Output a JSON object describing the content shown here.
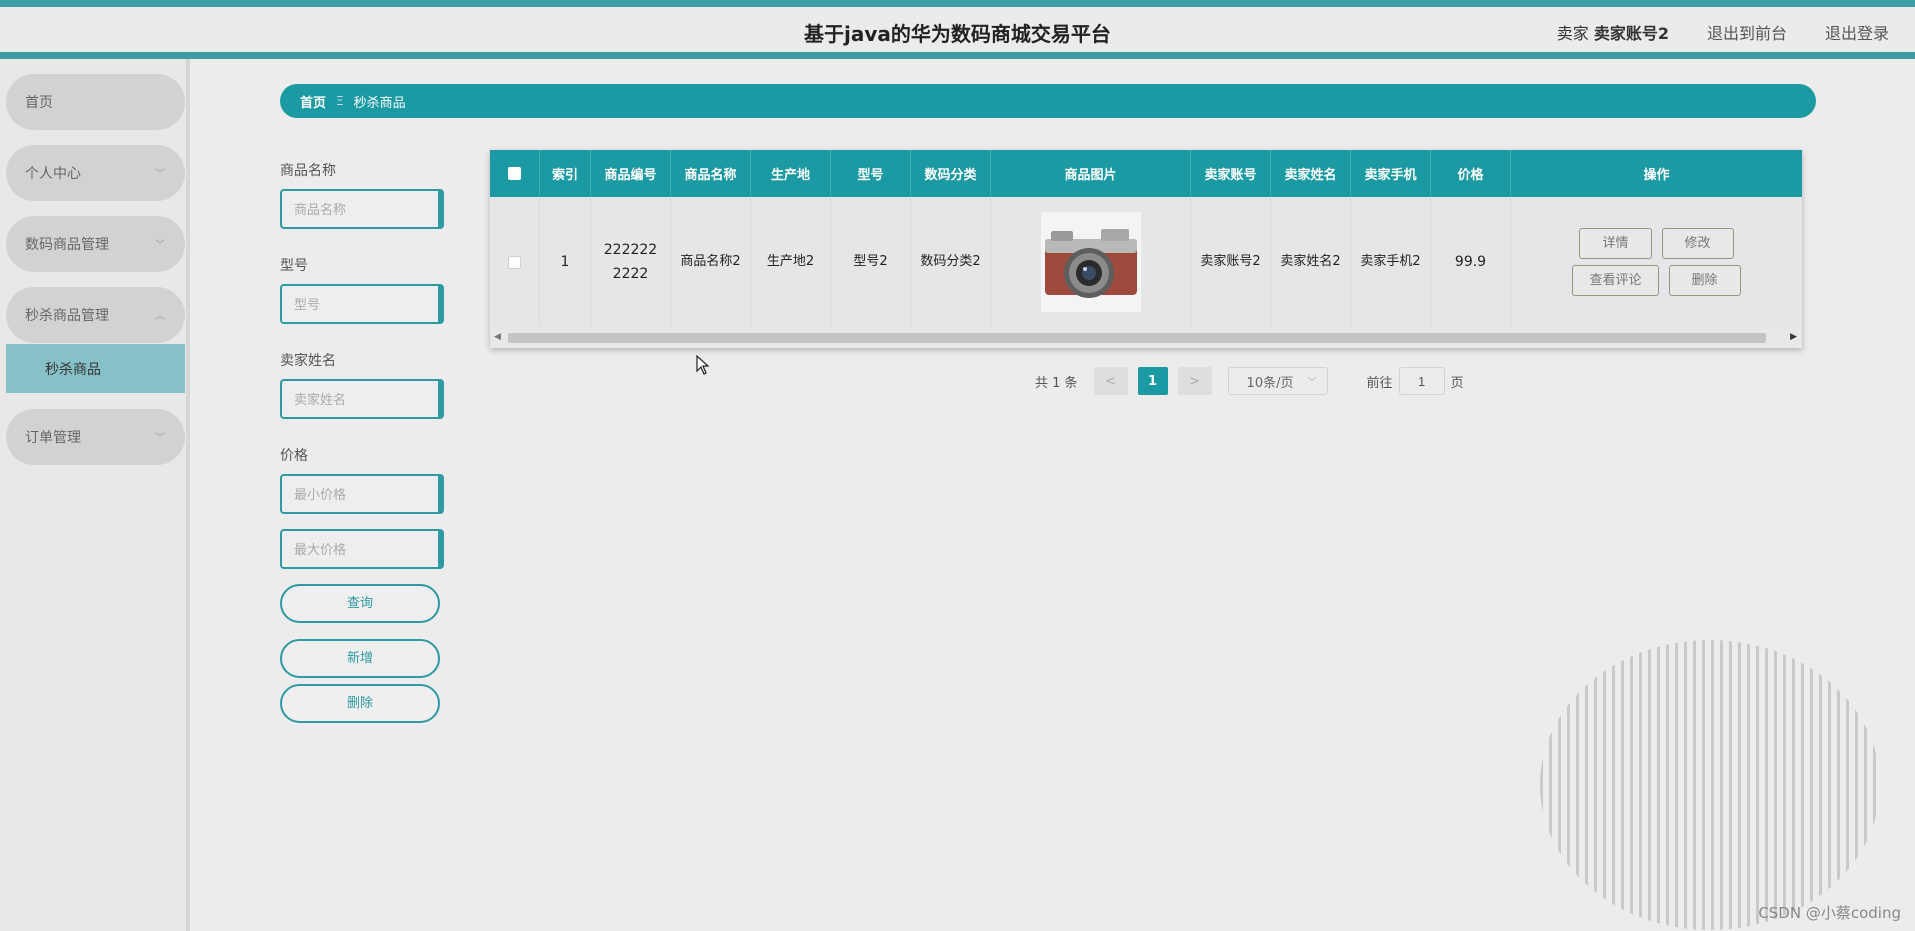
{
  "header": {
    "title": "基于java的华为数码商城交易平台",
    "user_role": "卖家",
    "user_name": "卖家账号2",
    "to_frontend": "退出到前台",
    "logout": "退出登录"
  },
  "sidebar": {
    "items": [
      {
        "label": "首页"
      },
      {
        "label": "个人中心"
      },
      {
        "label": "数码商品管理"
      },
      {
        "label": "秒杀商品管理"
      },
      {
        "label": "订单管理"
      }
    ],
    "submenu_active": "秒杀商品"
  },
  "breadcrumb": {
    "home": "首页",
    "separator": "Ξ",
    "current": "秒杀商品"
  },
  "search": {
    "name_label": "商品名称",
    "name_placeholder": "商品名称",
    "model_label": "型号",
    "model_placeholder": "型号",
    "seller_label": "卖家姓名",
    "seller_placeholder": "卖家姓名",
    "price_label": "价格",
    "min_price_placeholder": "最小价格",
    "max_price_placeholder": "最大价格",
    "query_label": "查询",
    "add_label": "新增",
    "delete_label": "删除"
  },
  "table": {
    "headers": [
      "索引",
      "商品编号",
      "商品名称",
      "生产地",
      "型号",
      "数码分类",
      "商品图片",
      "卖家账号",
      "卖家姓名",
      "卖家手机",
      "价格",
      "操作"
    ],
    "rows": [
      {
        "index": "1",
        "code": "2222222222",
        "name": "商品名称2",
        "origin": "生产地2",
        "model": "型号2",
        "category": "数码分类2",
        "image_icon": "camera-photo",
        "seller_account": "卖家账号2",
        "seller_name": "卖家姓名2",
        "seller_phone": "卖家手机2",
        "price": "99.9",
        "actions": {
          "detail": "详情",
          "edit": "修改",
          "reviews": "查看评论",
          "delete": "删除"
        }
      }
    ]
  },
  "pagination": {
    "total": "共 1 条",
    "prev": "<",
    "current_page": "1",
    "next": ">",
    "page_size": "10条/页",
    "goto_label": "前往",
    "goto_value": "1",
    "page_suffix": "页"
  },
  "watermark": "CSDN @小蔡coding",
  "colors": {
    "accent": "#1b9aa3",
    "header_border": "#3e9ca5",
    "submenu_active": "#86c1c8"
  }
}
